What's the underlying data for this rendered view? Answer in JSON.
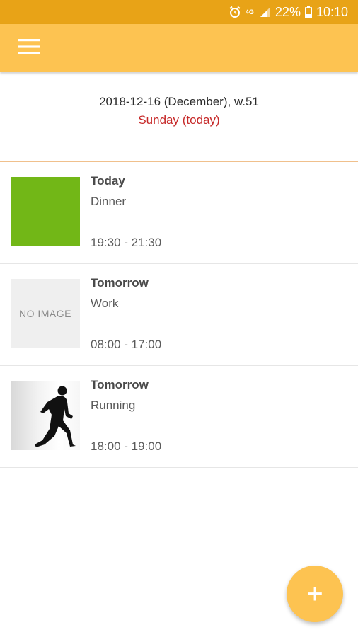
{
  "status_bar": {
    "network": "4G",
    "battery_percent": "22%",
    "time": "10:10",
    "icons": [
      "alarm-icon",
      "network-4g-icon",
      "signal-icon",
      "battery-icon"
    ]
  },
  "app_bar": {
    "menu_icon": "hamburger-menu-icon",
    "color": "#fdc351"
  },
  "header": {
    "date_line": "2018-12-16 (December), w.51",
    "day_line": "Sunday (today)",
    "day_color": "#c62828"
  },
  "events": [
    {
      "when": "Today",
      "title": "Dinner",
      "time": "19:30 - 21:30",
      "thumbnail": "green-color-swatch"
    },
    {
      "when": "Tomorrow",
      "title": "Work",
      "time": "08:00 - 17:00",
      "thumbnail": "no-image-placeholder",
      "thumbnail_text": "NO IMAGE"
    },
    {
      "when": "Tomorrow",
      "title": "Running",
      "time": "18:00 - 19:00",
      "thumbnail": "runner-silhouette-image"
    }
  ],
  "fab": {
    "label": "+",
    "icon": "add-icon"
  },
  "colors": {
    "status_bar": "#e8a317",
    "accent": "#fdc351",
    "dinner_swatch": "#72b717"
  }
}
